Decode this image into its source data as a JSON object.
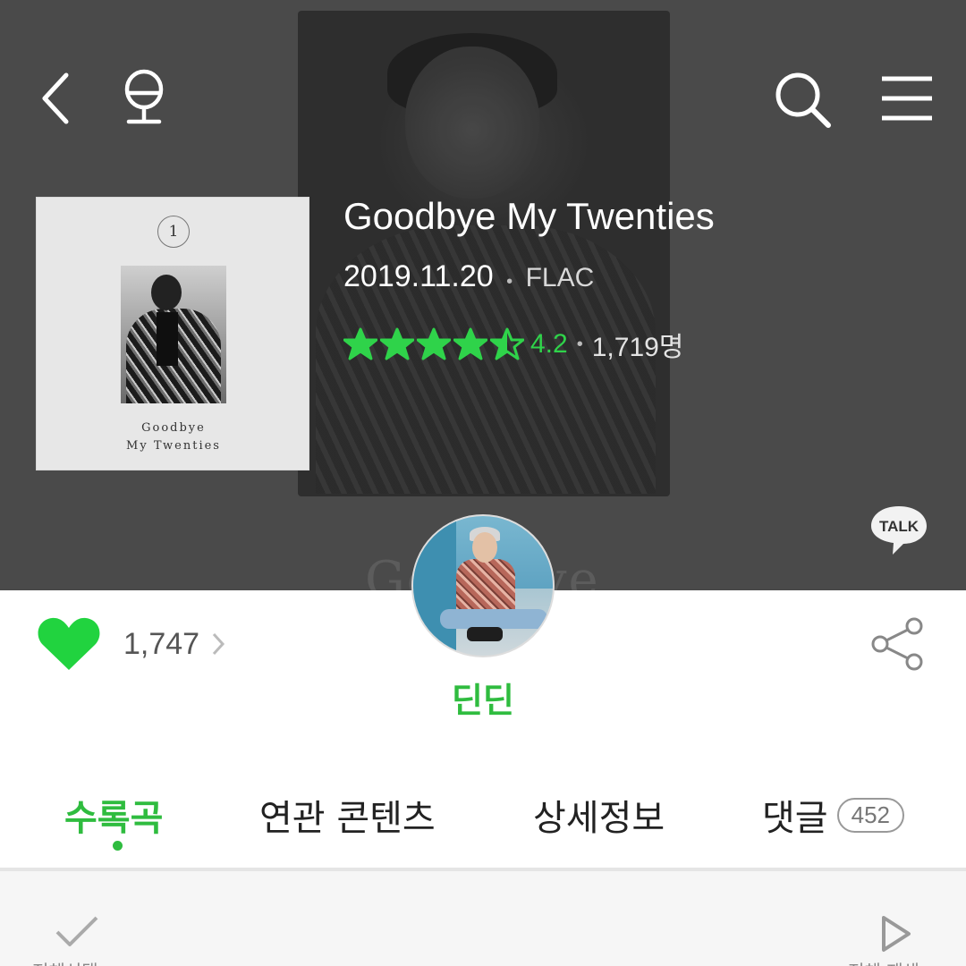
{
  "header": {
    "ghost_text": "Goodbye"
  },
  "album": {
    "cover_badge": "1",
    "cover_title_line1": "Goodbye",
    "cover_title_line2": "My Twenties",
    "title": "Goodbye My Twenties",
    "release_date": "2019.11.20",
    "separator": "•",
    "format": "FLAC",
    "rating": {
      "stars": 4.2,
      "value_text": "4.2",
      "count_text": "1,719명"
    }
  },
  "like": {
    "count": "1,747"
  },
  "artist": {
    "name": "딘딘"
  },
  "talk_button": {
    "label": "TALK"
  },
  "tabs": [
    {
      "label": "수록곡",
      "active": true
    },
    {
      "label": "연관 콘텐츠",
      "active": false
    },
    {
      "label": "상세정보",
      "active": false
    },
    {
      "label": "댓글",
      "badge": "452",
      "active": false
    }
  ],
  "bottom_bar": {
    "left_label": "전체선택",
    "right_label": "전체 재생"
  },
  "colors": {
    "accent_green": "#2fbc3f",
    "star_green": "#2fd34a",
    "header_bg": "#4a4a4a"
  },
  "icons": [
    "back-arrow-icon",
    "microphone-icon",
    "search-icon",
    "hamburger-menu-icon",
    "star-icon",
    "heart-icon",
    "chevron-right-icon",
    "share-icon",
    "checkmark-icon",
    "play-icon",
    "talk-bubble-icon"
  ]
}
